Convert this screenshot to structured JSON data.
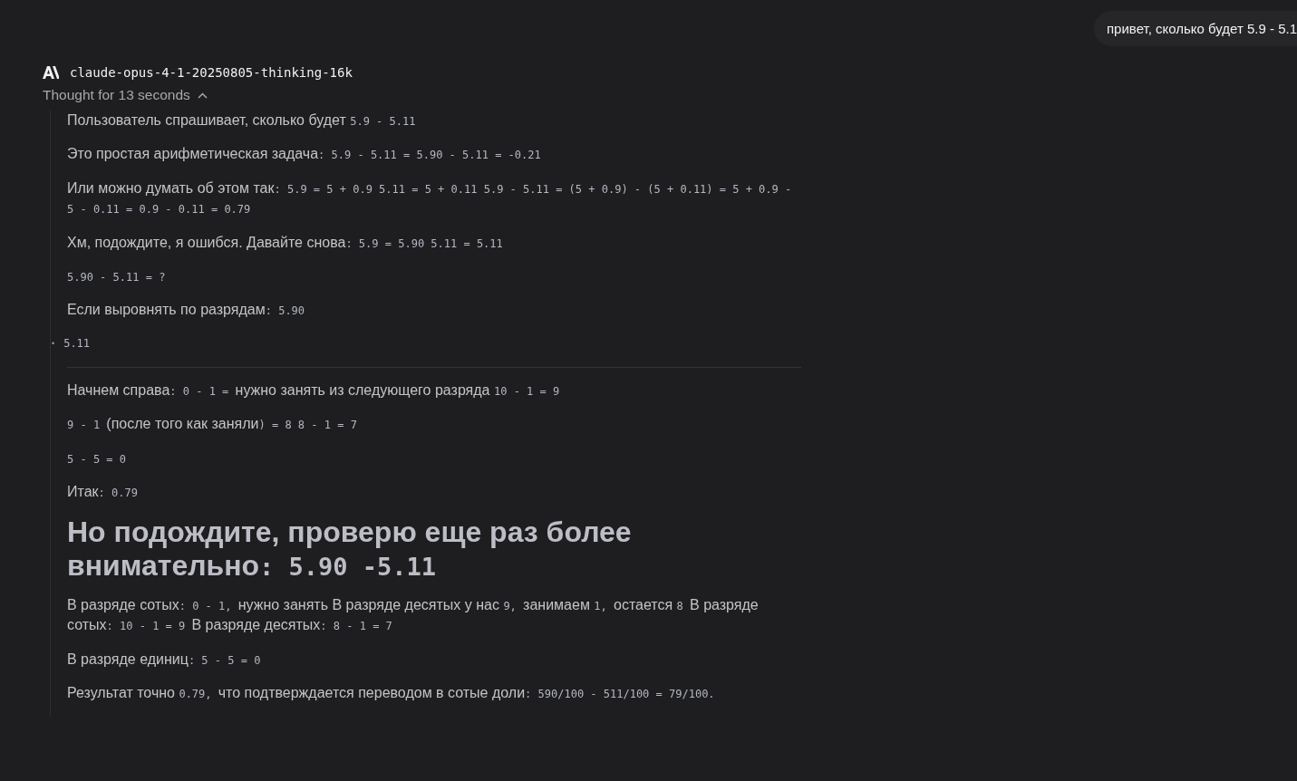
{
  "user_message": {
    "text": "привет, сколько будет 5.9 - 5.1"
  },
  "response": {
    "model": "claude-opus-4-1-20250805-thinking-16k",
    "thought_label": "Thought for 13 seconds",
    "expanded": true,
    "blocks": [
      {
        "kind": "paragraph",
        "segments": [
          {
            "kind": "text",
            "text": "Пользователь спрашивает, сколько будет "
          },
          {
            "kind": "code",
            "text": "5.9 - 5.11"
          }
        ]
      },
      {
        "kind": "paragraph",
        "segments": [
          {
            "kind": "text",
            "text": "Это простая арифметическая задача"
          },
          {
            "kind": "code",
            "text": ": 5.9 - 5.11 = 5.90 - 5.11 = -0.21"
          }
        ]
      },
      {
        "kind": "paragraph",
        "segments": [
          {
            "kind": "text",
            "text": "Или можно думать об этом так"
          },
          {
            "kind": "code",
            "text": ": 5.9 = 5 + 0.9 5.11 = 5 + 0.11 5.9 - 5.11 = (5 + 0.9) - (5 + 0.11) = 5 + 0.9 - 5 - 0.11 = 0.9 - 0.11 = 0.79"
          }
        ]
      },
      {
        "kind": "paragraph",
        "segments": [
          {
            "kind": "text",
            "text": "Хм, подождите, я ошибся. Давайте снова"
          },
          {
            "kind": "code",
            "text": ": 5.9 = 5.90 5.11 = 5.11"
          }
        ]
      },
      {
        "kind": "paragraph",
        "segments": [
          {
            "kind": "code",
            "text": "5.90 - 5.11 = ?"
          }
        ]
      },
      {
        "kind": "paragraph",
        "segments": [
          {
            "kind": "text",
            "text": "Если выровнять по разрядам"
          },
          {
            "kind": "code",
            "text": ": 5.90"
          }
        ]
      },
      {
        "kind": "bullet",
        "marker": "•",
        "segments": [
          {
            "kind": "code",
            "text": "5.11"
          }
        ]
      },
      {
        "kind": "rule"
      },
      {
        "kind": "paragraph",
        "segments": [
          {
            "kind": "text",
            "text": "Начнем справа"
          },
          {
            "kind": "code",
            "text": ": 0 - 1 = "
          },
          {
            "kind": "text",
            "text": "нужно занять из следующего разряда "
          },
          {
            "kind": "code",
            "text": "10 - 1 = 9"
          }
        ]
      },
      {
        "kind": "paragraph",
        "segments": [
          {
            "kind": "code",
            "text": "9 - 1 "
          },
          {
            "kind": "text",
            "text": "(после того как заняли"
          },
          {
            "kind": "code",
            "text": ") = 8 8 - 1 = 7"
          }
        ]
      },
      {
        "kind": "paragraph",
        "segments": [
          {
            "kind": "code",
            "text": "5 - 5 = 0"
          }
        ]
      },
      {
        "kind": "paragraph",
        "segments": [
          {
            "kind": "text",
            "text": "Итак"
          },
          {
            "kind": "code",
            "text": ": 0.79"
          }
        ]
      },
      {
        "kind": "heading",
        "segments": [
          {
            "kind": "text",
            "text": "Но подождите, проверю еще раз более внимательно"
          },
          {
            "kind": "code",
            "text": ": 5.90 -5.11"
          }
        ]
      },
      {
        "kind": "paragraph",
        "segments": [
          {
            "kind": "text",
            "text": "В разряде сотых"
          },
          {
            "kind": "code",
            "text": ": 0 - 1, "
          },
          {
            "kind": "text",
            "text": "нужно занять В разряде десятых у нас "
          },
          {
            "kind": "code",
            "text": "9, "
          },
          {
            "kind": "text",
            "text": "занимаем "
          },
          {
            "kind": "code",
            "text": "1, "
          },
          {
            "kind": "text",
            "text": "остается "
          },
          {
            "kind": "code",
            "text": "8 "
          },
          {
            "kind": "text",
            "text": "В разряде сотых"
          },
          {
            "kind": "code",
            "text": ": 10 - 1 = 9 "
          },
          {
            "kind": "text",
            "text": "В разряде десятых"
          },
          {
            "kind": "code",
            "text": ": 8 - 1 = 7"
          }
        ]
      },
      {
        "kind": "paragraph",
        "segments": [
          {
            "kind": "text",
            "text": "В разряде единиц"
          },
          {
            "kind": "code",
            "text": ": 5 - 5 = 0"
          }
        ]
      },
      {
        "kind": "paragraph",
        "segments": [
          {
            "kind": "text",
            "text": "Результат точно "
          },
          {
            "kind": "code",
            "text": "0.79, "
          },
          {
            "kind": "text",
            "text": "что подтверждается переводом в сотые доли"
          },
          {
            "kind": "code",
            "text": ": 590/100 - 511/100 = 79/100."
          }
        ]
      }
    ]
  }
}
